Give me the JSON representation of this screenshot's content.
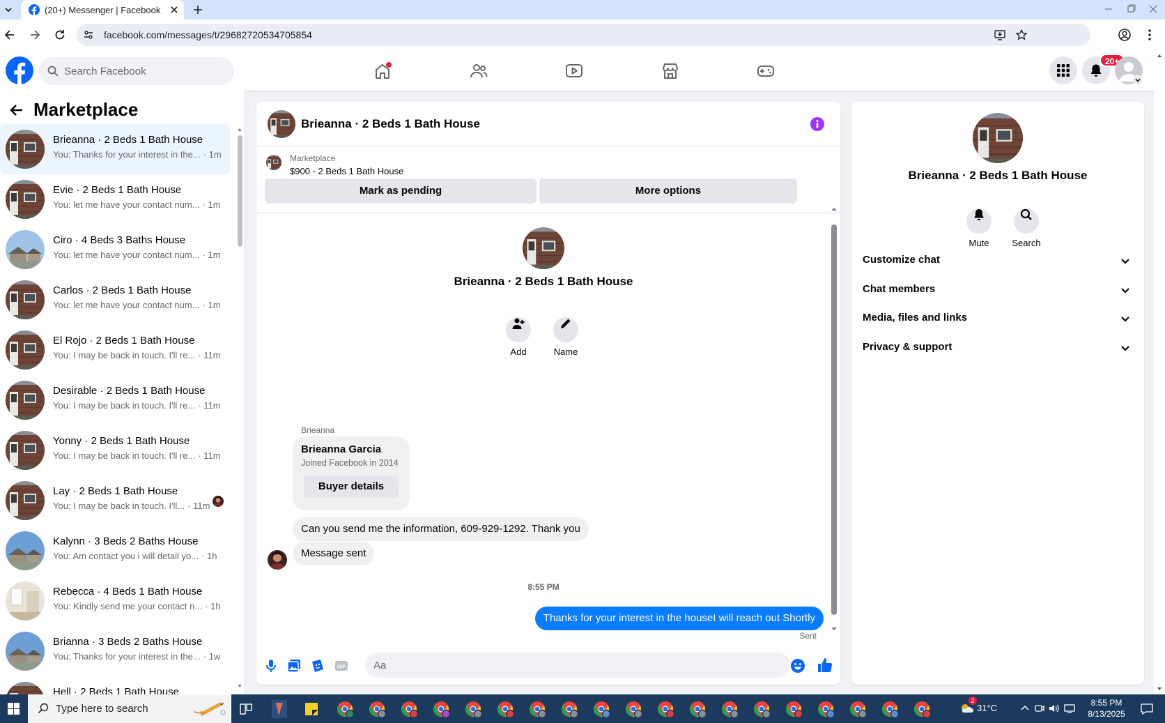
{
  "browser": {
    "tab_title": "(20+) Messenger | Facebook",
    "url": "facebook.com/messages/t/29682720534705854"
  },
  "fb_header": {
    "search_placeholder": "Search Facebook",
    "notification_badge": "20+"
  },
  "left_panel": {
    "title": "Marketplace",
    "conversations": [
      {
        "name": "Brieanna · 2 Beds 1 Bath House",
        "preview": "You: Thanks for your interest in the...",
        "time": "· 1m",
        "selected": true
      },
      {
        "name": "Evie · 2 Beds 1 Bath House",
        "preview": "You: let me have your contact num...",
        "time": "· 1m"
      },
      {
        "name": "Ciro · 4 Beds 3 Baths House",
        "preview": "You: let me have your contact num...",
        "time": "· 1m"
      },
      {
        "name": "Carlos · 2 Beds 1 Bath House",
        "preview": "You: let me have your contact num...",
        "time": "· 1m"
      },
      {
        "name": "El Rojo · 2 Beds 1 Bath House",
        "preview": "You: I may be back in touch. I'll re...",
        "time": "· 11m"
      },
      {
        "name": "Desirable · 2 Beds 1 Bath House",
        "preview": "You: I may be back in touch. I'll re...",
        "time": "· 11m"
      },
      {
        "name": "Yonny · 2 Beds 1 Bath House",
        "preview": "You: I may be back in touch. I'll re...",
        "time": "· 11m"
      },
      {
        "name": "Lay · 2 Beds 1 Bath House",
        "preview": "You: I may be back in touch. I'll...",
        "time": "· 11m"
      },
      {
        "name": "Kalynn · 3 Beds 2 Baths House",
        "preview": "You: Am contact you i will detail yo...",
        "time": "· 1h"
      },
      {
        "name": "Rebecca · 4 Beds 1 Bath House",
        "preview": "You: Kindly send me your contact n...",
        "time": "· 1h"
      },
      {
        "name": "Brianna · 3 Beds 2 Baths House",
        "preview": "You: Thanks for your interest in the...",
        "time": "· 1w"
      },
      {
        "name": "Hell · 2 Beds 1 Bath House",
        "preview": "",
        "time": ""
      }
    ]
  },
  "chat": {
    "title": "Brieanna · 2 Beds 1 Bath House",
    "listing_source": "Marketplace",
    "listing_price": "$900 - 2 Beds 1 Bath House",
    "mark_pending_label": "Mark as pending",
    "more_options_label": "More options",
    "profile_name": "Brieanna · 2 Beds 1 Bath House",
    "add_label": "Add",
    "name_label": "Name",
    "sender_label": "Brieanna",
    "card_name": "Brieanna Garcia",
    "card_sub": "Joined Facebook in 2014",
    "buyer_details_label": "Buyer details",
    "msg_1": "Can you send me the information, 609-929-1292. Thank you",
    "msg_2": "Message sent",
    "timestamp": "8:55 PM",
    "outgoing": "Thanks for your interest in the houseI will reach out Shortly",
    "status": "Sent",
    "composer_placeholder": "Aa"
  },
  "right_panel": {
    "name": "Brieanna · 2 Beds 1 Bath House",
    "mute_label": "Mute",
    "search_label": "Search",
    "sections": [
      "Customize chat",
      "Chat members",
      "Media, files and links",
      "Privacy & support"
    ]
  },
  "taskbar": {
    "search_placeholder": "Type here to search",
    "temperature": "31°C",
    "time": "8:55 PM",
    "date": "8/13/2025"
  },
  "colors": {
    "fb_blue": "#0866ff",
    "messenger_blue": "#0a7cff",
    "badge_red": "#e41e3f",
    "info_purple": "#a033ff"
  }
}
